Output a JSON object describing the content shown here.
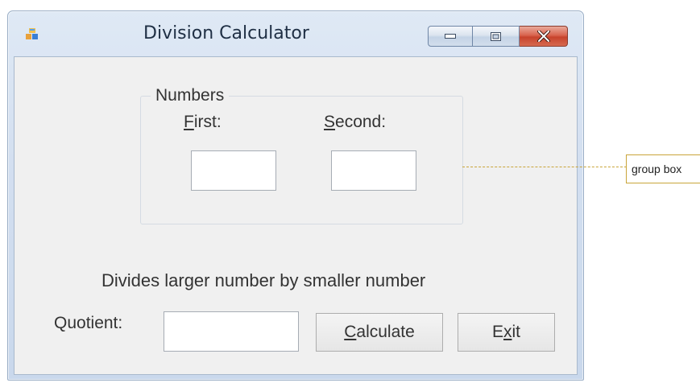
{
  "window": {
    "title": "Division Calculator",
    "icons": {
      "app": "form-icon",
      "minimize": "minimize-icon",
      "maximize": "maximize-icon",
      "close": "close-icon"
    }
  },
  "group": {
    "title": "Numbers",
    "first_label": {
      "mnemonic": "F",
      "rest": "irst:"
    },
    "second_label": {
      "mnemonic": "S",
      "rest": "econd:"
    },
    "first_value": "",
    "second_value": ""
  },
  "description": "Divides larger number by smaller number",
  "quotient": {
    "label": "Quotient:",
    "value": ""
  },
  "buttons": {
    "calculate": {
      "before": "",
      "mnemonic": "C",
      "after": "alculate"
    },
    "exit": {
      "before": "E",
      "mnemonic": "x",
      "after": "it"
    }
  },
  "callout": {
    "text": "group box",
    "color": "#c9a53a"
  }
}
